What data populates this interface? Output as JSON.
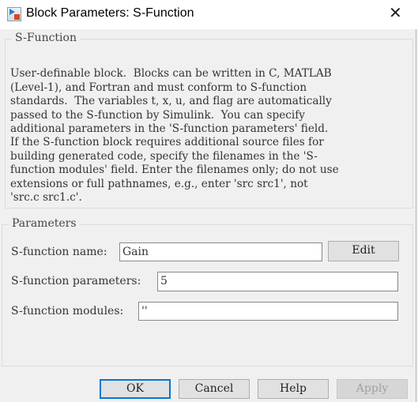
{
  "window": {
    "title": "Block Parameters: S-Function",
    "close_icon": "close-icon",
    "app_icon": "simulink-block-icon"
  },
  "description_group": {
    "title": "S-Function",
    "lines": [
      "User-definable block.  Blocks can be written in C, MATLAB",
      "(Level-1), and Fortran and must conform to S-function",
      "standards.  The variables t, x, u, and flag are automatically",
      "passed to the S-function by Simulink.  You can specify",
      "additional parameters in the 'S-function parameters' field.",
      "If the S-function block requires additional source files for",
      "building generated code, specify the filenames in the 'S-",
      "function modules' field. Enter the filenames only; do not use",
      "extensions or full pathnames, e.g., enter 'src src1', not",
      "'src.c src1.c'."
    ]
  },
  "parameters": {
    "title": "Parameters",
    "name_label": "S-function name:",
    "name_value": "Gain",
    "edit_label": "Edit",
    "params_label": "S-function parameters:",
    "params_value": "5",
    "modules_label": "S-function modules:",
    "modules_value": "''"
  },
  "buttons": {
    "ok": "OK",
    "cancel": "Cancel",
    "help": "Help",
    "apply": "Apply",
    "apply_enabled": false
  }
}
